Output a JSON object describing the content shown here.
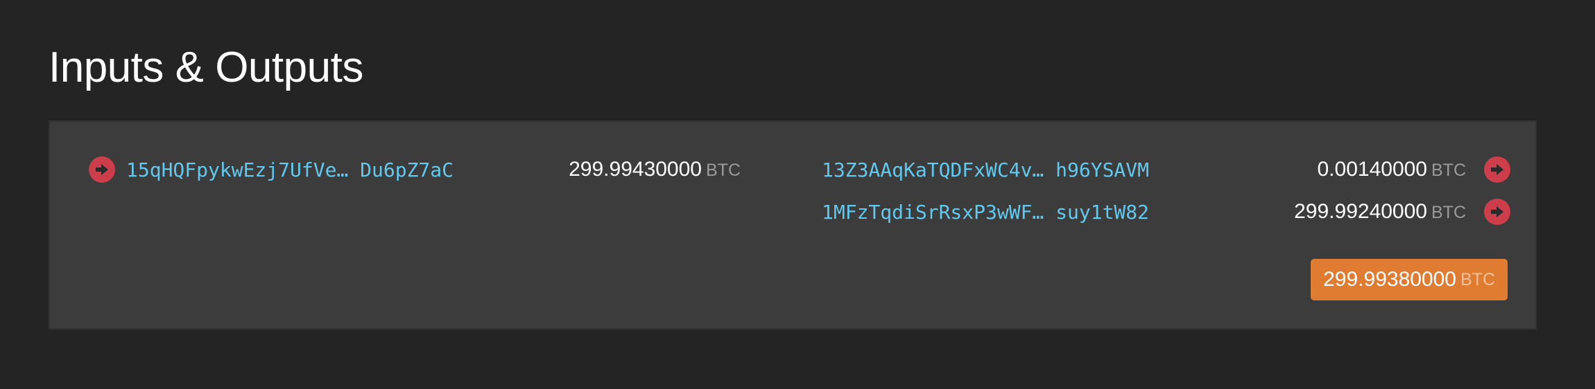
{
  "section": {
    "title": "Inputs & Outputs"
  },
  "inputs": [
    {
      "address": "15qHQFpykwEzj7UfVe… Du6pZ7aC",
      "amount": "299.99430000",
      "unit": "BTC"
    }
  ],
  "outputs": [
    {
      "address": "13Z3AAqKaTQDFxWC4v… h96YSAVM",
      "amount": "0.00140000",
      "unit": "BTC"
    },
    {
      "address": "1MFzTqdiSrRsxP3wWF… suy1tW82",
      "amount": "299.99240000",
      "unit": "BTC"
    }
  ],
  "total": {
    "amount": "299.99380000",
    "unit": "BTC"
  },
  "colors": {
    "background": "#242424",
    "panel": "#3c3c3c",
    "address": "#62c9ee",
    "arrow_icon": "#cc3e4a",
    "total_badge": "#e07b32"
  },
  "icons": {
    "input_marker": "arrow-right-circle-icon",
    "output_link": "arrow-right-circle-icon"
  }
}
